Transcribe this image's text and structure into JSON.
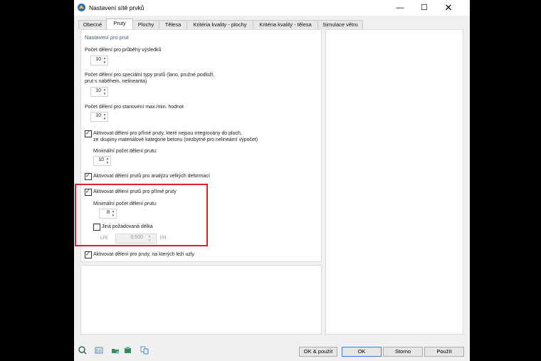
{
  "window": {
    "title": "Nastavení sítě prvků",
    "controls": {
      "minimize": "—",
      "maximize": "☐",
      "close": "✕"
    }
  },
  "tabs": [
    {
      "label": "Obecné",
      "active": false
    },
    {
      "label": "Pruty",
      "active": true
    },
    {
      "label": "Plochy",
      "active": false
    },
    {
      "label": "Tělesa",
      "active": false
    },
    {
      "label": "Kritéria kvality - plochy",
      "active": false
    },
    {
      "label": "Kritéria kvality - tělesa",
      "active": false
    },
    {
      "label": "Simulace větru",
      "active": false
    }
  ],
  "panel": {
    "section_title": "Nastavení pro prut",
    "results_divisions": {
      "label": "Počet dělení pro průběhy výsledků",
      "value": "10"
    },
    "special_divisions": {
      "label_line1": "Počet dělení pro speciální typy prutů (lano, pružné podloží,",
      "label_line2": "prut s náběhem, nelinearita)",
      "value": "10"
    },
    "maxmin_divisions": {
      "label": "Počet dělení pro stanovení max./min. hodnot",
      "value": "10"
    },
    "straight_not_integrated": {
      "checked": true,
      "label_line1": "Aktivovat dělení pro přímé pruty, které nejsou integrovány do ploch,",
      "label_line2": "ze skupiny materiálové kategorie betonu (nezbytné pro nelineární výpočet)",
      "min_label": "Minimální počet dělení prutu:",
      "min_value": "10"
    },
    "large_deformation": {
      "checked": true,
      "label": "Aktivovat dělení prutů pro analýzu velkých deformací"
    },
    "straight_members": {
      "checked": true,
      "label": "Aktivovat dělení prutů pro přímé pruty",
      "min_label": "Minimální počet dělení prutu:",
      "min_value": "8",
      "other_length": {
        "checked": false,
        "label": "Jiná požadovaná délka"
      },
      "lfe_label": "LFE",
      "lfe_value": "0.500",
      "lfe_unit": "[m]"
    },
    "members_with_nodes": {
      "checked": true,
      "label": "Aktivovat dělení pro pruty, na kterých leží uzly"
    }
  },
  "buttons": {
    "ok_apply": "OK & použít",
    "ok": "OK",
    "cancel": "Storno",
    "apply": "Použít"
  },
  "toolbar_icons": [
    "help-icon",
    "units-icon",
    "load-settings-icon",
    "save-settings-icon",
    "copy-icon"
  ],
  "colors": {
    "highlight": "#e0202a",
    "section_title": "#3a5a8c",
    "primary_border": "#3b7bd9"
  }
}
